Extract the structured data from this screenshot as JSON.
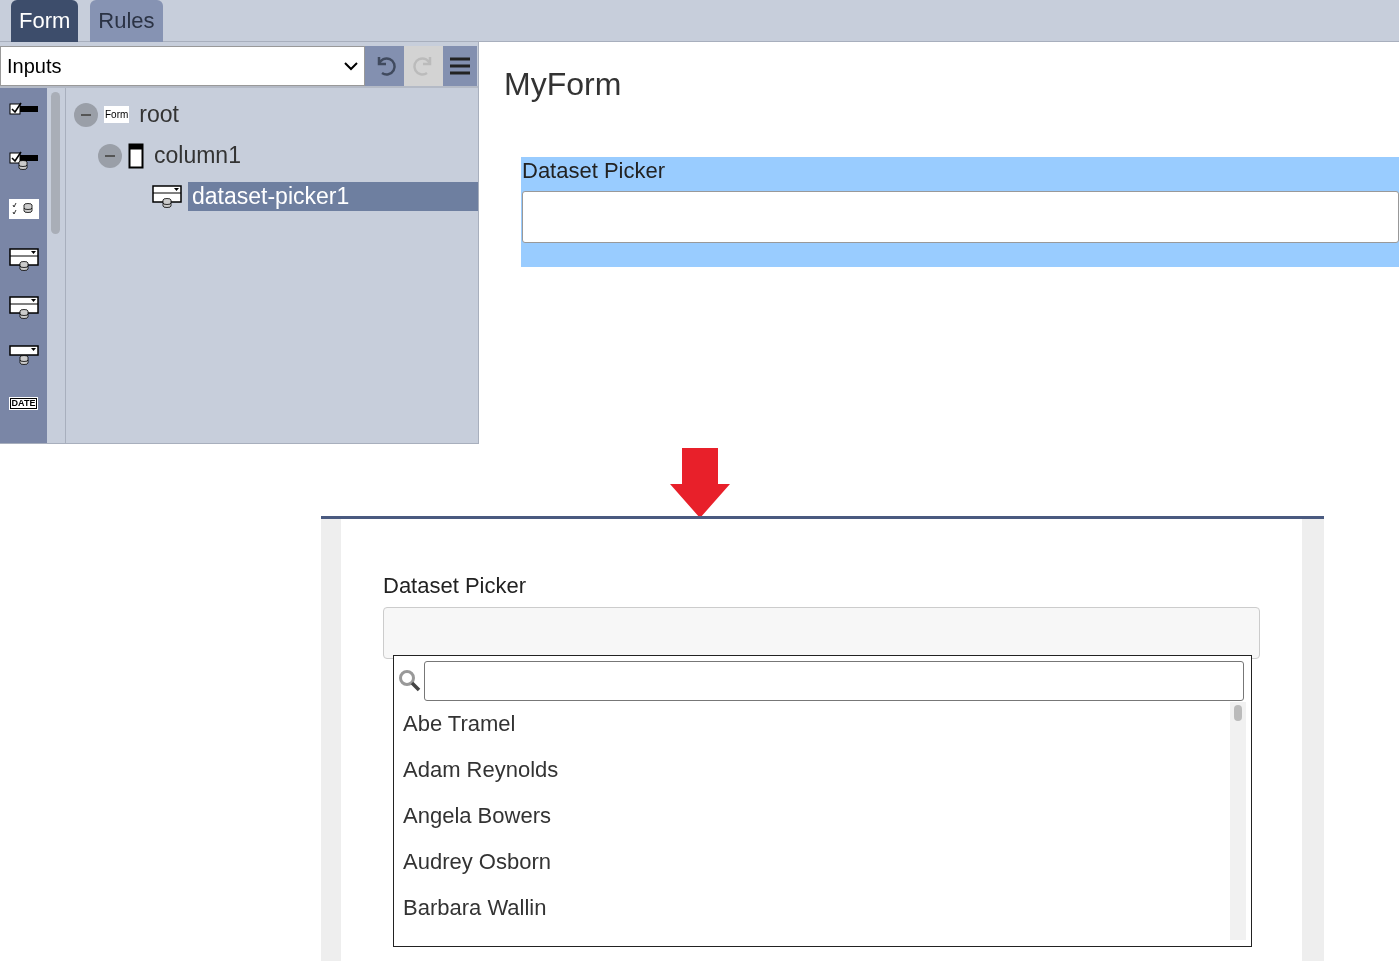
{
  "tabs": [
    {
      "label": "Form",
      "selected": true
    },
    {
      "label": "Rules",
      "selected": false
    }
  ],
  "toolbar": {
    "category": "Inputs",
    "undo": {
      "disabled": false
    },
    "redo": {
      "disabled": true
    }
  },
  "palette": [
    {
      "kind": "checkbox"
    },
    {
      "kind": "checkbox-dataset"
    },
    {
      "kind": "checklist-dataset"
    },
    {
      "kind": "picker-dataset"
    },
    {
      "kind": "picker-dataset"
    },
    {
      "kind": "dropdown-dataset"
    },
    {
      "kind": "date",
      "label": "DATE"
    }
  ],
  "tree": [
    {
      "kind": "form",
      "badge": "Form",
      "label": "root",
      "expanded": true,
      "selected": false,
      "children": [
        {
          "kind": "column",
          "label": "column1",
          "expanded": true,
          "selected": false,
          "children": [
            {
              "kind": "picker",
              "label": "dataset-picker1",
              "selected": true
            }
          ]
        }
      ]
    }
  ],
  "canvas": {
    "title": "MyForm",
    "field": {
      "label": "Dataset Picker",
      "selected": true
    }
  },
  "preview": {
    "label": "Dataset Picker",
    "dropdown": {
      "options": [
        "Abe Tramel",
        "Adam Reynolds",
        "Angela Bowers",
        "Audrey Osborn",
        "Barbara Wallin"
      ]
    }
  }
}
